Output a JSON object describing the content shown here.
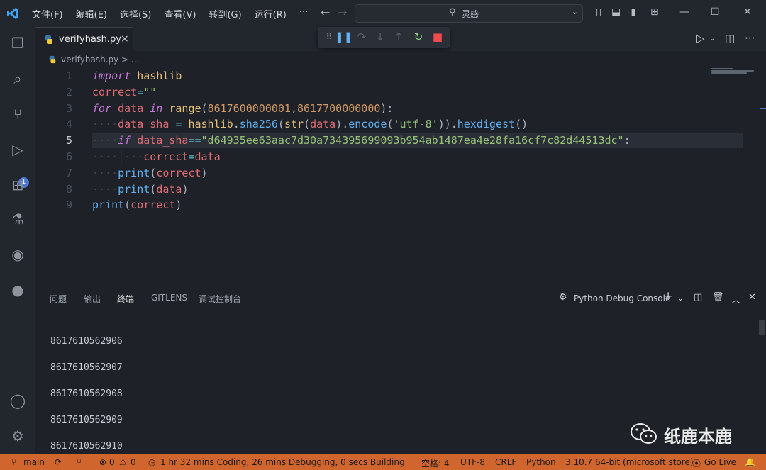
{
  "menu": [
    "文件(F)",
    "编辑(E)",
    "选择(S)",
    "查看(V)",
    "转到(G)",
    "运行(R)",
    "···"
  ],
  "search": {
    "label": "灵感"
  },
  "tab": {
    "name": "verifyhash.py",
    "close": "×"
  },
  "breadcrumb": "verifyhash.py > ...",
  "activity_badge": "1",
  "editor": {
    "line_numbers": [
      "1",
      "2",
      "3",
      "4",
      "5",
      "6",
      "7",
      "8",
      "9"
    ],
    "current_line": "5"
  },
  "panel": {
    "tabs": [
      "问题",
      "输出",
      "终端",
      "GITLENS",
      "调试控制台"
    ],
    "active_tab": "终端",
    "console_name": "Python Debug Console",
    "terminal_lines": [
      "8617610562906",
      "8617610562907",
      "8617610562908",
      "8617610562909",
      "8617610562910"
    ]
  },
  "watermark": "纸鹿本鹿",
  "status": {
    "branch": "main",
    "errors": "0",
    "warnings": "0",
    "timing": "1 hr 32 mins Coding, 26 mins Debugging, 0 secs Building",
    "spaces": "空格: 4",
    "encoding": "UTF-8",
    "eol": "CRLF",
    "language": "Python",
    "interpreter": "3.10.7 64-bit (microsoft store)",
    "golive": "Go Live"
  },
  "colors": {
    "statusbar": "#d1652e",
    "keyword": "#c678dd",
    "string": "#98c379",
    "number": "#d19a66",
    "accent": "#4d78cc"
  }
}
